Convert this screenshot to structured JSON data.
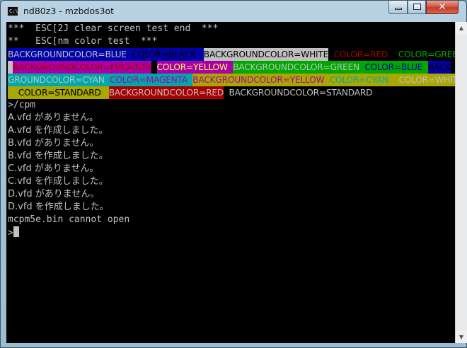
{
  "window": {
    "title": "nd80z3 - mzbdos3ot",
    "icon_text": "C:\\"
  },
  "controls": {
    "minimize": "minimize",
    "maximize": "maximize",
    "close": "✕"
  },
  "colors": {
    "black": "#000000",
    "blue": "#0000a8",
    "white": "#c0c0c0",
    "red": "#a80000",
    "green": "#00a800",
    "magenta": "#a800a8",
    "yellow": "#a8a800",
    "cyan": "#00a8a8",
    "standard": "#c0c0c0",
    "yellow_text": "#ffff55"
  },
  "lines": [
    {
      "text": "***  ESC[2J clear screen test end  ***"
    },
    {
      "text": "**   ESC[nm color test  ***"
    },
    {
      "segments": [
        {
          "text": "BACKGROUNDCOLOR=BLUE",
          "fg": "#c0c0c0",
          "bg": "#0000a8"
        },
        {
          "text": "  COLOR=BLACK   ",
          "fg": "#000000",
          "bg": "#0000a8"
        },
        {
          "text": "BACKGROUNDCOLOR=WHITE",
          "fg": "#000000",
          "bg": "#c0c0c0"
        },
        {
          "text": "  COLOR=RED  ",
          "fg": "#a80000",
          "bg": "#000000"
        },
        {
          "text": "  COLOR=GREEN",
          "fg": "#00a800",
          "bg": "#000000"
        }
      ]
    },
    {
      "segments": [
        {
          "text": "  ",
          "fg": "#000000",
          "bg": "#c0c0c0"
        },
        {
          "text": "BACKGROUNDCOLOR=MAGENTA",
          "fg": "#a80000",
          "bg": "#a800a8"
        },
        {
          "text": "  ",
          "fg": "#000000",
          "bg": "#000000"
        },
        {
          "text": "COLOR=YELLOW",
          "fg": "#ffff55",
          "bg": "#a800a8"
        },
        {
          "text": "  ",
          "fg": "#000000",
          "bg": "#a800a8"
        },
        {
          "text": "BACKGROUNDCOLOR=GREEN",
          "fg": "#c0c0c0",
          "bg": "#00a800"
        },
        {
          "text": "  COLOR=BLUE  ",
          "fg": "#0000a8",
          "bg": "#00a800"
        },
        {
          "text": "BACK",
          "fg": "#000000",
          "bg": "#0000a8"
        }
      ]
    },
    {
      "segments": [
        {
          "text": "GROUNDCOLOR=CYAN",
          "fg": "#c0c0c0",
          "bg": "#00a8a8"
        },
        {
          "text": "  COLOR=MAGENTA  ",
          "fg": "#a800a8",
          "bg": "#00a8a8"
        },
        {
          "text": "BACKGROUNDCOLOR=YELLOW",
          "fg": "#a800a8",
          "bg": "#a8a800"
        },
        {
          "text": "  COLOR=CYAN  ",
          "fg": "#00a8a8",
          "bg": "#a8a800"
        },
        {
          "text": "  COLOR=WHITE",
          "fg": "#c0c0c0",
          "bg": "#a8a800"
        }
      ]
    },
    {
      "segments": [
        {
          "text": "    COLOR=STANDARD   ",
          "fg": "#000000",
          "bg": "#a8a800"
        },
        {
          "text": "BACKGROUNDCOLOR=RED",
          "fg": "#c0c0c0",
          "bg": "#a80000"
        },
        {
          "text": "  BACKGROUNDCOLOR=STANDARD",
          "fg": "#c0c0c0",
          "bg": "#000000"
        }
      ]
    },
    {
      "text": ">/cpm"
    },
    {
      "text": "A.vfd がありません。",
      "cjk": true
    },
    {
      "text": "A.vfd を作成しました。",
      "cjk": true
    },
    {
      "text": "B.vfd がありません。",
      "cjk": true
    },
    {
      "text": "B.vfd を作成しました。",
      "cjk": true
    },
    {
      "text": "C.vfd がありません。",
      "cjk": true
    },
    {
      "text": "C.vfd を作成しました。",
      "cjk": true
    },
    {
      "text": "D.vfd がありません。",
      "cjk": true
    },
    {
      "text": "D.vfd を作成しました。",
      "cjk": true
    },
    {
      "text": "mcpm5e.bin cannot open"
    },
    {
      "text": ">",
      "cursor": true
    }
  ]
}
